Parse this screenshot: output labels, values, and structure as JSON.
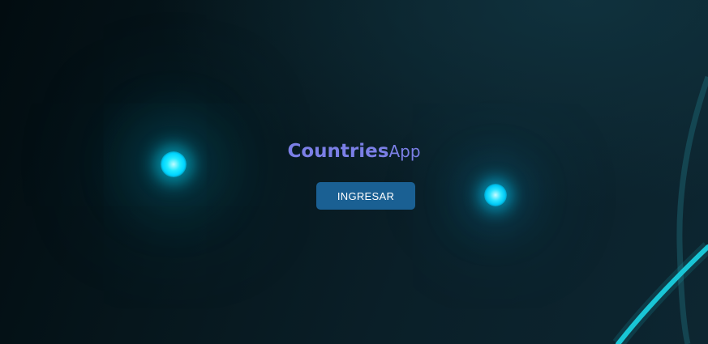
{
  "app_title": {
    "bold": "Countries",
    "light": "App",
    "color": "#7b7fe6"
  },
  "login_button": {
    "label": "INGRESAR",
    "background": "#1a6093",
    "text_color": "#ffffff"
  },
  "background": {
    "base_colors": [
      "#020c10",
      "#0d2631"
    ],
    "accent_glow": "#00d4ff",
    "ring_color": "#1ac8d8"
  }
}
